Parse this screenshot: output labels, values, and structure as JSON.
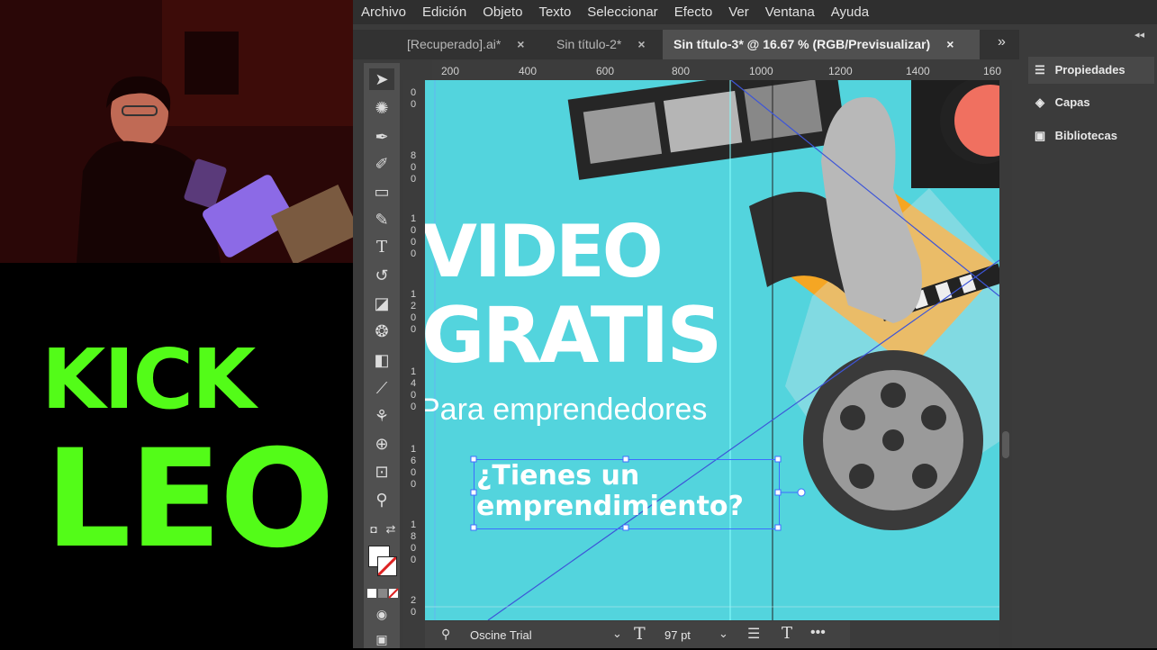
{
  "overlay": {
    "brand_line1": "KICK",
    "brand_line2": "LEO"
  },
  "menubar": [
    "Archivo",
    "Edición",
    "Objeto",
    "Texto",
    "Seleccionar",
    "Efecto",
    "Ver",
    "Ventana",
    "Ayuda"
  ],
  "tabs": [
    {
      "label": "[Recuperado].ai*",
      "close": "×"
    },
    {
      "label": "Sin título-2*",
      "close": "×"
    },
    {
      "label": "Sin título-3* @ 16.67 % (RGB/Previsualizar)",
      "close": "×"
    }
  ],
  "ruler_top": [
    "200",
    "400",
    "600",
    "800",
    "1000",
    "1200",
    "1400",
    "160"
  ],
  "ruler_left": [
    [
      "0",
      "0"
    ],
    [
      "8",
      "0",
      "0"
    ],
    [
      "1",
      "0",
      "0",
      "0"
    ],
    [
      "1",
      "2",
      "0",
      "0"
    ],
    [
      "1",
      "4",
      "0",
      "0"
    ],
    [
      "1",
      "6",
      "0",
      "0"
    ],
    [
      "1",
      "8",
      "0",
      "0"
    ],
    [
      "2",
      "0"
    ]
  ],
  "canvas": {
    "headline1": "VIDEO",
    "headline2": "GRATIS",
    "subtitle": "Para emprendedores",
    "question1": "¿Tienes un",
    "question2": "emprendimiento?"
  },
  "panel": {
    "items": [
      {
        "label": "Propiedades",
        "icon": "sliders-icon"
      },
      {
        "label": "Capas",
        "icon": "layers-icon"
      },
      {
        "label": "Bibliotecas",
        "icon": "libraries-icon"
      }
    ]
  },
  "control_bar": {
    "font": "Oscine Trial",
    "size": "97 pt"
  },
  "colors": {
    "kick_green": "#53fc18",
    "canvas_bg": "#53d4dd",
    "accent_orange": "#f5a623",
    "accent_coral": "#f07060"
  }
}
